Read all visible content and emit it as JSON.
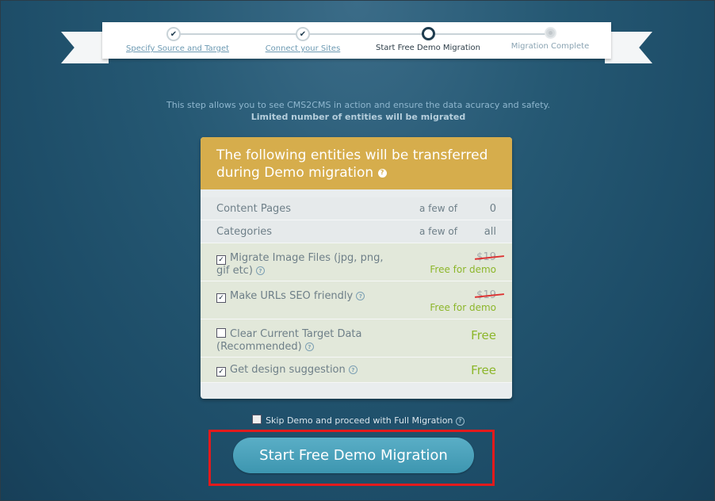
{
  "steps": [
    {
      "label": "Specify Source and Target",
      "state": "done"
    },
    {
      "label": "Connect your Sites",
      "state": "done"
    },
    {
      "label": "Start Free Demo Migration",
      "state": "current"
    },
    {
      "label": "Migration Complete",
      "state": "todo"
    }
  ],
  "intro": {
    "line1": "This step allows you to see CMS2CMS in action and ensure the data acuracy and safety.",
    "line2": "Limited number of entities will be migrated"
  },
  "card": {
    "title": "The following entities will be transferred during Demo migration",
    "info_rows": [
      {
        "label": "Content Pages",
        "qty": "a few of",
        "total": "0"
      },
      {
        "label": "Categories",
        "qty": "a few of",
        "total": "all"
      }
    ],
    "options": [
      {
        "label": "Migrate Image Files (jpg, png, gif etc)",
        "checked": true,
        "old_price": "$19",
        "price": "Free for demo"
      },
      {
        "label": "Make URLs SEO friendly",
        "checked": true,
        "old_price": "$19",
        "price": "Free for demo"
      },
      {
        "label": "Clear Current Target Data (Recommended)",
        "checked": false,
        "price": "Free"
      },
      {
        "label": "Get design suggestion",
        "checked": true,
        "price": "Free"
      }
    ]
  },
  "skip_label": "Skip Demo and proceed with Full Migration",
  "start_button": "Start Free Demo Migration",
  "colors": {
    "accent": "#d6ad4c",
    "button": "#4aa3bd",
    "free": "#8cb62a",
    "highlight": "#e31a1c"
  }
}
